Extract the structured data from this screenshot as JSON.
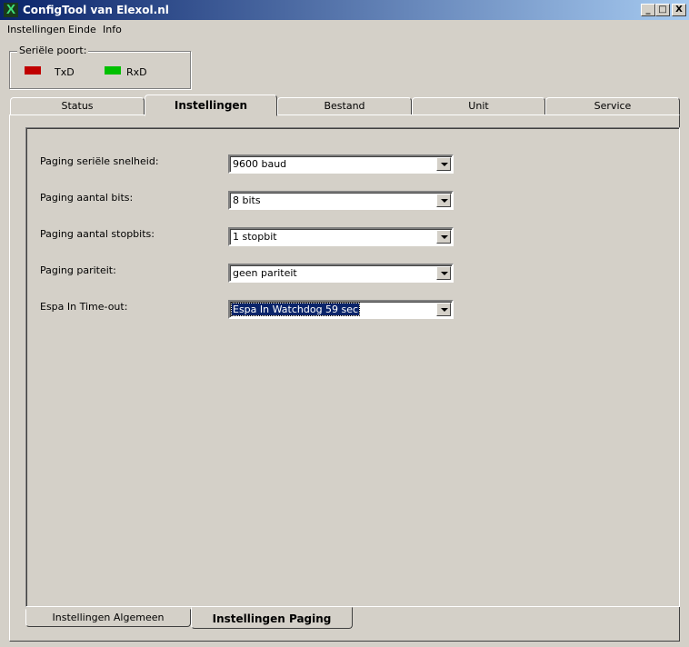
{
  "window": {
    "title": "ConfigTool van Elexol.nl",
    "app_icon_glyph": "X"
  },
  "window_controls": {
    "minimize": "_",
    "maximize": "□",
    "close": "X"
  },
  "menu": [
    "Instellingen",
    "Einde",
    "Info"
  ],
  "serial_port": {
    "legend": "Seriële poort:",
    "tx_label": "TxD",
    "tx_color": "#c00000",
    "rx_label": "RxD",
    "rx_color": "#00c000"
  },
  "tabs": [
    "Status",
    "Instellingen",
    "Bestand",
    "Unit",
    "Service"
  ],
  "active_tab": "Instellingen",
  "fields": [
    {
      "label": "Paging seriële snelheid:",
      "value": "9600 baud"
    },
    {
      "label": "Paging aantal bits:",
      "value": "8 bits"
    },
    {
      "label": "Paging aantal stopbits:",
      "value": "1 stopbit"
    },
    {
      "label": "Paging pariteit:",
      "value": "geen pariteit"
    },
    {
      "label": "Espa In Time-out:",
      "value": "Espa In Watchdog 59 sec"
    }
  ],
  "bottom_tabs": [
    "Instellingen Algemeen",
    "Instellingen Paging"
  ],
  "active_bottom_tab": "Instellingen Paging"
}
